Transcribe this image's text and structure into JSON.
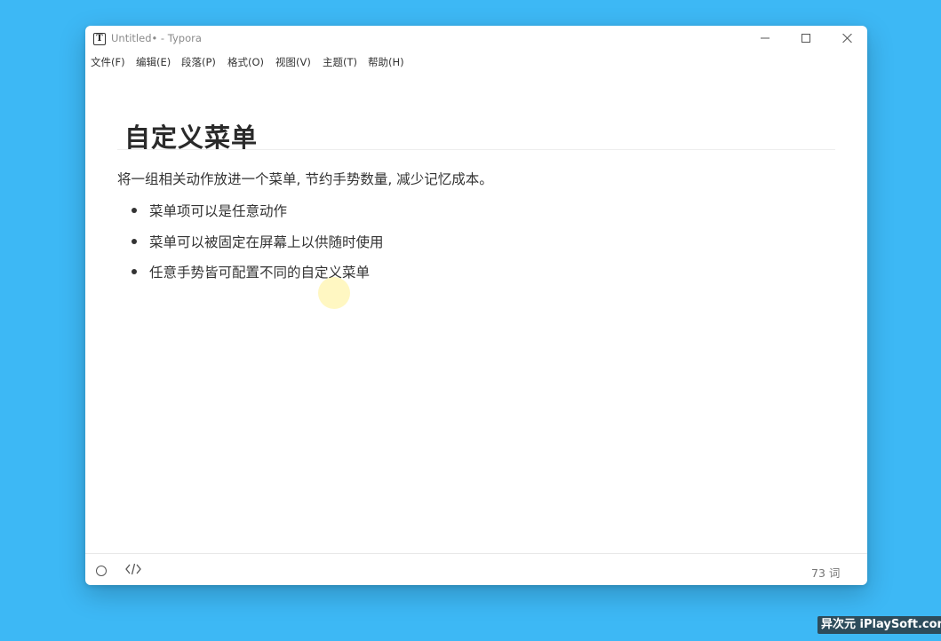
{
  "window": {
    "app_icon_letter": "T",
    "title": "Untitled• - Typora"
  },
  "menubar": {
    "items": [
      {
        "label": "文件(F)"
      },
      {
        "label": "编辑(E)"
      },
      {
        "label": "段落(P)"
      },
      {
        "label": "格式(O)"
      },
      {
        "label": "视图(V)"
      },
      {
        "label": "主题(T)"
      },
      {
        "label": "帮助(H)"
      }
    ]
  },
  "document": {
    "heading": "自定义菜单",
    "paragraph": "将一组相关动作放进一个菜单, 节约手势数量, 减少记忆成本。",
    "bullets": [
      "菜单项可以是任意动作",
      "菜单可以被固定在屏幕上以供随时使用",
      "任意手势皆可配置不同的自定义菜单"
    ]
  },
  "statusbar": {
    "word_count": "73 词"
  },
  "watermark": {
    "text": "异次元 iPlaySoft.com"
  },
  "icons": {
    "app": "typora-icon",
    "minimize": "minimize-icon",
    "maximize": "maximize-icon",
    "close": "close-icon",
    "outline": "outline-circle-icon",
    "source_mode": "source-code-icon"
  },
  "colors": {
    "desktop_background": "#3db8f5",
    "window_background": "#ffffff",
    "text": "#333333"
  }
}
